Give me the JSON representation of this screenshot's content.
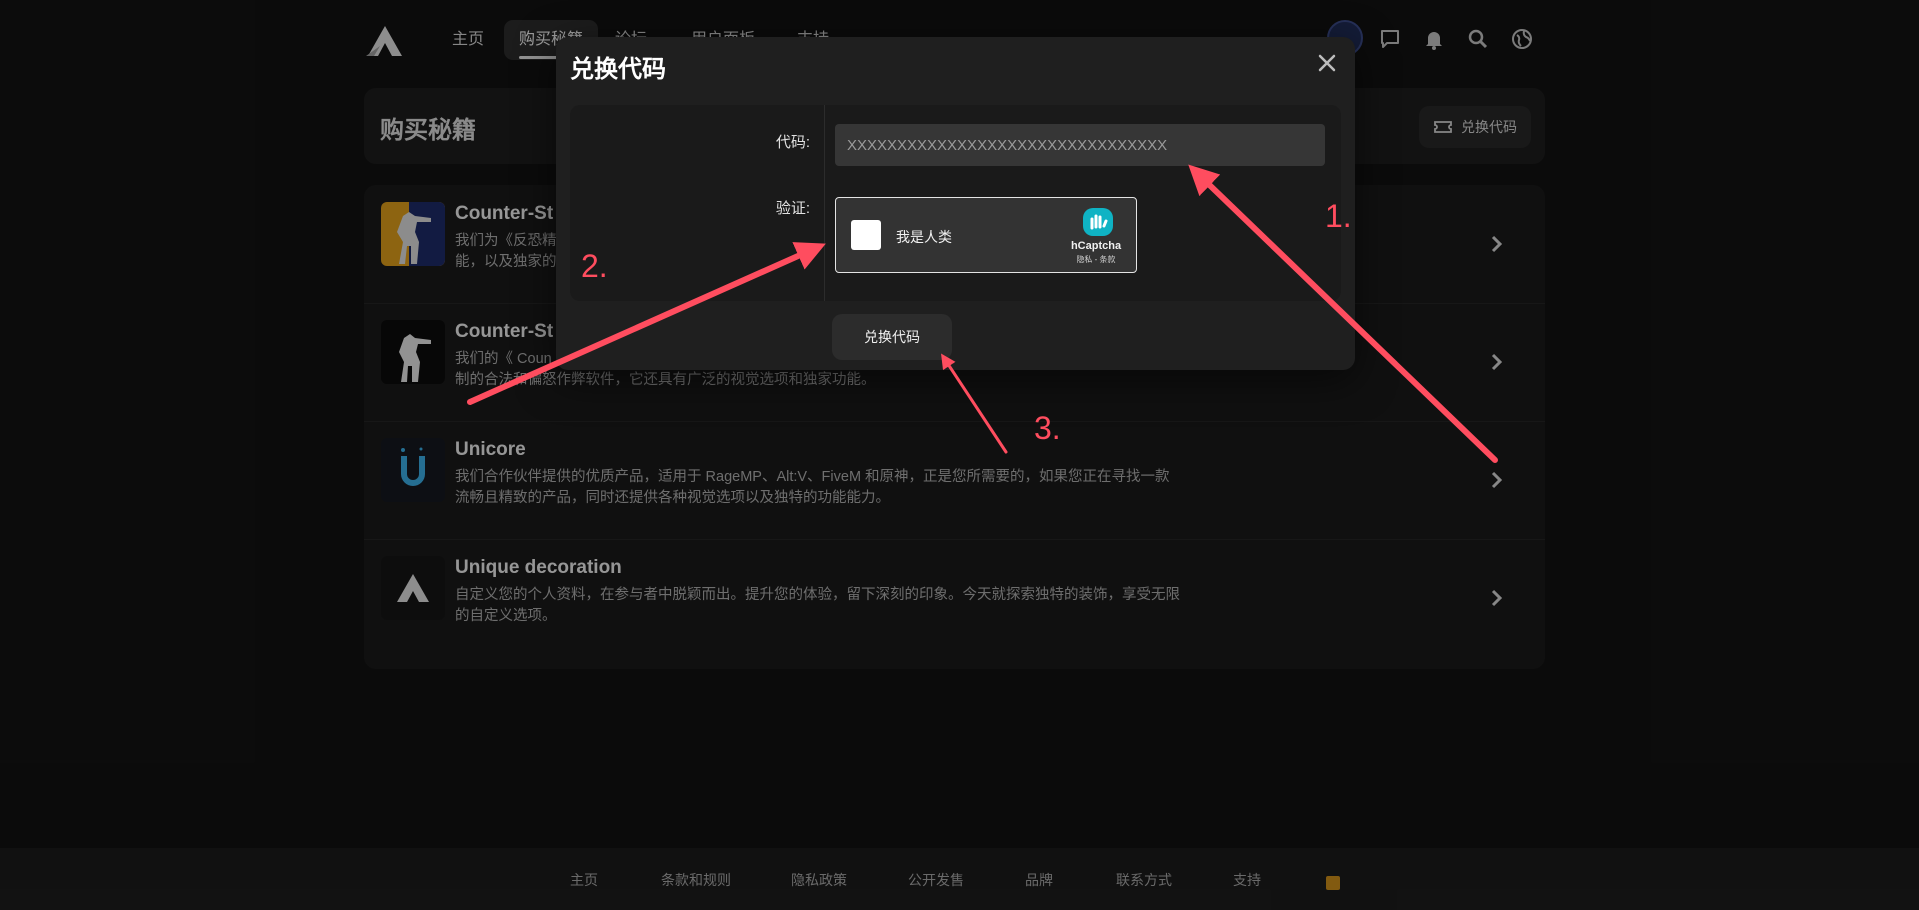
{
  "nav": {
    "items": [
      {
        "label": "主页"
      },
      {
        "label": "购买秘籍"
      },
      {
        "label": "论坛"
      },
      {
        "label": "用户面板"
      },
      {
        "label": "支持"
      }
    ],
    "icons": [
      "avatar",
      "chat-icon",
      "bell-icon",
      "search-icon",
      "globe-icon"
    ]
  },
  "page": {
    "title": "购买秘籍",
    "redeem_button": "兑换代码"
  },
  "products": [
    {
      "name": "Counter-St",
      "desc": "我们为《反恐精",
      "desc2": "能，以及独家的",
      "image": "cs-orange"
    },
    {
      "name": "Counter-St",
      "desc": "我们的《 Coun",
      "desc2": "制的合法和偏怒作弊软件，它还具有广泛的视觉选项和独家功能。",
      "image": "cs-black"
    },
    {
      "name": "Unicore",
      "desc": "我们合作伙伴提供的优质产品，适用于 RageMP、Alt:V、FiveM 和原神，正是您所需要的，如果您正在寻找一款",
      "desc2": "流畅且精致的产品，同时还提供各种视觉选项以及独特的功能能力。",
      "image": "unicore"
    },
    {
      "name": "Unique decoration",
      "desc": "自定义您的个人资料，在参与者中脱颖而出。提升您的体验，留下深刻的印象。今天就探索独特的装饰，享受无限",
      "desc2": "的自定义选项。",
      "image": "logo-dark"
    }
  ],
  "modal": {
    "title": "兑换代码",
    "code_label": "代码:",
    "code_placeholder": "XXXXXXXXXXXXXXXXXXXXXXXXXXXXXXXX",
    "verify_label": "验证:",
    "captcha": {
      "label": "我是人类",
      "brand": "hCaptcha",
      "links": "隐私 - 条款"
    },
    "submit": "兑换代码"
  },
  "footer": {
    "links": [
      "主页",
      "条款和规则",
      "隐私政策",
      "公开发售",
      "品牌",
      "联系方式",
      "支持"
    ]
  },
  "annotations": [
    "1.",
    "2.",
    "3."
  ],
  "colors": {
    "accent": "#ff4d5f",
    "background": "#121212",
    "card": "#1a1a1a",
    "modal": "#1f1f1f"
  }
}
